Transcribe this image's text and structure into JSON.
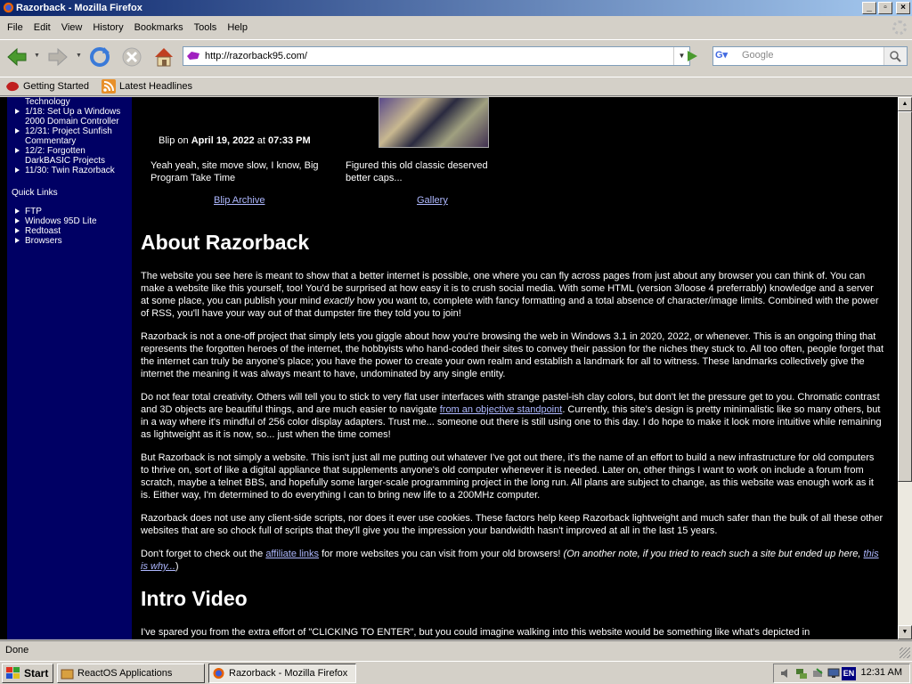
{
  "window": {
    "title": "Razorback - Mozilla Firefox"
  },
  "menubar": {
    "items": [
      "File",
      "Edit",
      "View",
      "History",
      "Bookmarks",
      "Tools",
      "Help"
    ]
  },
  "navbar": {
    "url": "http://razorback95.com/",
    "search_placeholder": "Google"
  },
  "bookmarks": {
    "items": [
      "Getting Started",
      "Latest Headlines"
    ]
  },
  "sidebar": {
    "top_items": [
      {
        "text": "Technology",
        "bullet": false
      },
      {
        "text": "1/18: Set Up a Windows 2000 Domain Controller",
        "bullet": true
      },
      {
        "text": "12/31: Project Sunfish Commentary",
        "bullet": true
      },
      {
        "text": "12/2: Forgotten DarkBASIC Projects",
        "bullet": true
      },
      {
        "text": "11/30: Twin Razorback",
        "bullet": true
      }
    ],
    "quick_links_heading": "Quick Links",
    "quick_links": [
      "FTP",
      "Windows 95D Lite",
      "Redtoast",
      "Browsers"
    ]
  },
  "main": {
    "blip": {
      "author": "Blip on",
      "date": "April 19, 2022",
      "at": "at",
      "time": "07:33 PM"
    },
    "blip_caption": "Yeah yeah, site move slow, I know, Big Program Take Time",
    "gallery_caption": "Figured this old classic deserved better caps...",
    "blip_archive_link": "Blip Archive",
    "gallery_link": "Gallery",
    "about_heading": "About Razorback",
    "p1a": "The website you see here is meant to show that a better internet is possible, one where you can fly across pages from just about any browser you can think of. You can make a website like this yourself, too! You'd be surprised at how easy it is to crush social media. With some HTML (version 3/loose 4 preferrably) knowledge and a server at some place, you can publish your mind",
    "p1_em": "exactly",
    "p1b": "how you want to, complete with fancy formatting and a total absence of character/image limits. Combined with the power of RSS, you'll have your way out of that dumpster fire they told you to join!",
    "p2": "Razorback is not a one-off project that simply lets you giggle about how you're browsing the web in Windows 3.1 in 2020, 2022, or whenever. This is an ongoing thing that represents the forgotten heroes of the internet, the hobbyists who hand-coded their sites to convey their passion for the niches they stuck to. All too often, people forget that the internet can truly be anyone's place; you have the power to create your own realm and establish a landmark for all to witness. These landmarks collectively give the internet the meaning it was always meant to have, undominated by any single entity.",
    "p3a": "Do not fear total creativity. Others will tell you to stick to very flat user interfaces with strange pastel-ish clay colors, but don't let the pressure get to you. Chromatic contrast and 3D objects are beautiful things, and are much easier to navigate",
    "p3_link": "from an objective standpoint",
    "p3b": ". Currently, this site's design is pretty minimalistic like so many others, but in a way where it's mindful of 256 color display adapters. Trust me... someone out there is still using one to this day. I do hope to make it look more intuitive while remaining as lightweight as it is now, so... just when the time comes!",
    "p4": "But Razorback is not simply a website. This isn't just all me putting out whatever I've got out there, it's the name of an effort to build a new infrastructure for old computers to thrive on, sort of like a digital appliance that supplements anyone's old computer whenever it is needed. Later on, other things I want to work on include a forum from scratch, maybe a telnet BBS, and hopefully some larger-scale programming project in the long run. All plans are subject to change, as this website was enough work as it is. Either way, I'm determined to do everything I can to bring new life to a 200MHz computer.",
    "p5": "Razorback does not use any client-side scripts, nor does it ever use cookies. These factors help keep Razorback lightweight and much safer than the bulk of all these other websites that are so chock full of scripts that they'll give you the impression your bandwidth hasn't improved at all in the last 15 years.",
    "p6a": "Don't forget to check out the",
    "p6_link": "affiliate links",
    "p6b": "for more websites you can visit from your old browsers!",
    "p6_em": "(On another note, if you tried to reach such a site but ended up here,",
    "p6_em_link": "this is why...",
    "p6_close": ")",
    "intro_heading": "Intro Video",
    "p7": "I've spared you from the extra effort of \"CLICKING TO ENTER\", but you could imagine walking into this website would be something like what's depicted in"
  },
  "status": {
    "text": "Done"
  },
  "taskbar": {
    "start": "Start",
    "tasks": [
      "ReactOS Applications Mana...",
      "Razorback - Mozilla Firefox"
    ],
    "lang": "EN",
    "clock": "12:31 AM"
  }
}
